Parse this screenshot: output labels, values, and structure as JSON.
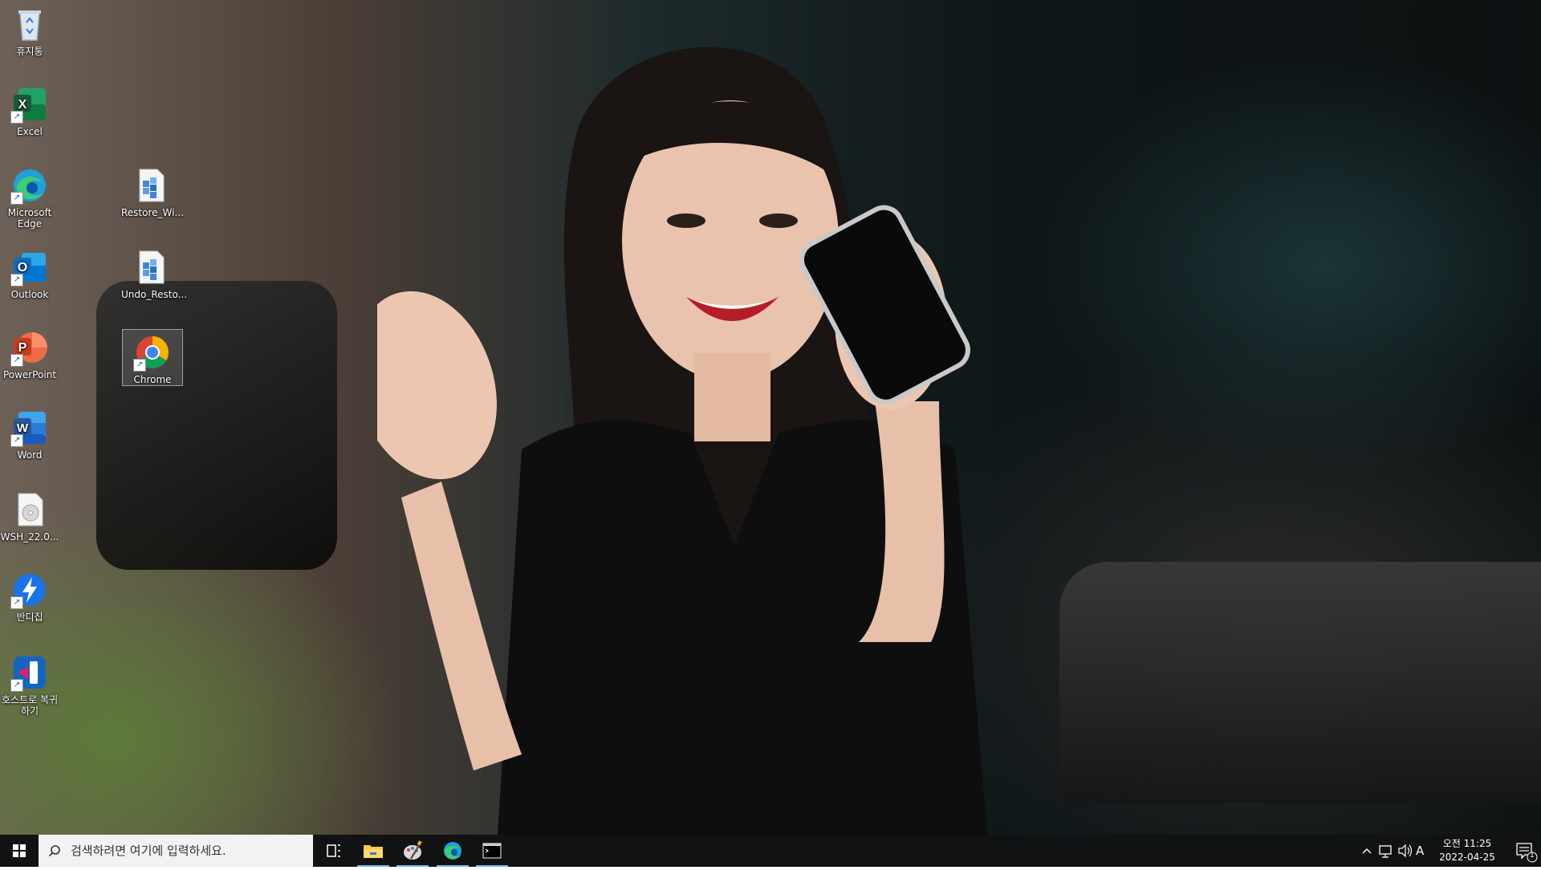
{
  "desktop": {
    "icons": [
      {
        "label": "휴지통",
        "icon": "recycle-bin-icon"
      },
      {
        "label": "Excel",
        "icon": "excel-icon"
      },
      {
        "label": "Microsoft Edge",
        "icon": "edge-icon"
      },
      {
        "label": "Outlook",
        "icon": "outlook-icon"
      },
      {
        "label": "PowerPoint",
        "icon": "powerpoint-icon"
      },
      {
        "label": "Word",
        "icon": "word-icon"
      },
      {
        "label": "WSH_22.0...",
        "icon": "disc-image-icon"
      },
      {
        "label": "반디집",
        "icon": "bandizip-icon"
      },
      {
        "label": "호스트로 복귀하기",
        "icon": "return-to-host-icon"
      },
      {
        "label": "Restore_Wi...",
        "icon": "registry-file-icon"
      },
      {
        "label": "Undo_Resto...",
        "icon": "registry-file-icon"
      },
      {
        "label": "Chrome",
        "icon": "chrome-icon"
      }
    ]
  },
  "taskbar": {
    "search_placeholder": "검색하려면 여기에 입력하세요.",
    "pinned": [
      {
        "name": "task-view",
        "icon": "task-view-icon"
      },
      {
        "name": "file-explorer",
        "icon": "folder-icon"
      },
      {
        "name": "paint",
        "icon": "paint-icon"
      },
      {
        "name": "edge",
        "icon": "edge-icon"
      },
      {
        "name": "terminal",
        "icon": "terminal-icon"
      }
    ],
    "tray": {
      "ime": "A",
      "notification_count": "1"
    },
    "clock": {
      "time": "오전 11:25",
      "date": "2022-04-25"
    }
  },
  "colors": {
    "taskbar_bg": "#111214",
    "active_indicator": "#76b9ed",
    "excel": "#1d6f42",
    "word": "#2b579a",
    "powerpoint": "#d24726",
    "outlook": "#0f6cbd",
    "edge": "#1fa0d8",
    "bandizip": "#1a73e8"
  }
}
